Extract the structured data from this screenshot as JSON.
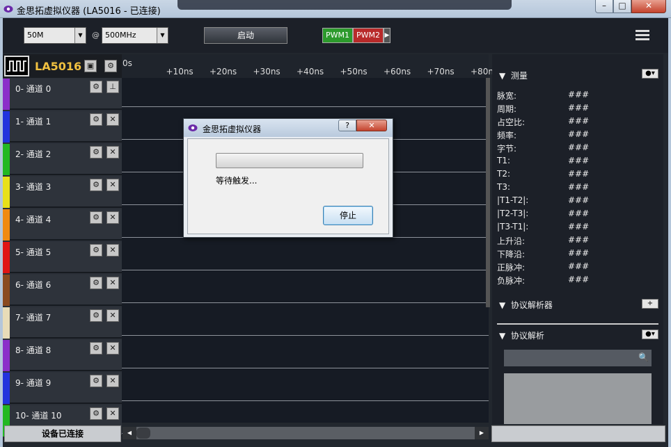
{
  "window": {
    "title": "金思拓虚拟仪器 (LA5016 - 已连接)",
    "min": "–",
    "max": "□",
    "close": "✕"
  },
  "toolbar": {
    "sample_count": "50M",
    "at_symbol": "@",
    "sample_rate": "500MHz",
    "start_label": "启动",
    "pwm1": "PWM1",
    "pwm2": "PWM2",
    "pwm_more": "▶"
  },
  "device": {
    "name": "LA5016"
  },
  "channels": [
    {
      "label": "0-  通道 0",
      "color": "#8b2fc9"
    },
    {
      "label": "1-  通道 1",
      "color": "#2233dd"
    },
    {
      "label": "2-  通道 2",
      "color": "#22b822"
    },
    {
      "label": "3-  通道 3",
      "color": "#e8e01a"
    },
    {
      "label": "4-  通道 4",
      "color": "#f08a10"
    },
    {
      "label": "5-  通道 5",
      "color": "#e01515"
    },
    {
      "label": "6-  通道 6",
      "color": "#8a4a20"
    },
    {
      "label": "7-  通道 7",
      "color": "#e8dcb8"
    },
    {
      "label": "8-  通道 8",
      "color": "#8b2fc9"
    },
    {
      "label": "9-  通道 9",
      "color": "#2233dd"
    },
    {
      "label": "10- 通道 10",
      "color": "#22b822"
    }
  ],
  "ruler": {
    "ticks": [
      "0s",
      "+10ns",
      "+20ns",
      "+30ns",
      "+40ns",
      "+50ns",
      "+60ns",
      "+70ns",
      "+80n"
    ]
  },
  "measure": {
    "title": "测量",
    "rows": [
      {
        "k": "脉宽:",
        "v": "###"
      },
      {
        "k": "周期:",
        "v": "###"
      },
      {
        "k": "占空比:",
        "v": "###"
      },
      {
        "k": "频率:",
        "v": "###"
      },
      {
        "k": "字节:",
        "v": "###"
      },
      {
        "k": "T1:",
        "v": "###"
      },
      {
        "k": "T2:",
        "v": "###"
      },
      {
        "k": "T3:",
        "v": "###"
      },
      {
        "k": "|T1-T2|:",
        "v": "###"
      },
      {
        "k": "|T2-T3|:",
        "v": "###"
      },
      {
        "k": "|T3-T1|:",
        "v": "###"
      },
      {
        "k": "上升沿:",
        "v": "###"
      },
      {
        "k": "下降沿:",
        "v": "###"
      },
      {
        "k": "正脉冲:",
        "v": "###"
      },
      {
        "k": "负脉冲:",
        "v": "###"
      }
    ]
  },
  "analyzers": {
    "title": "协议解析器",
    "add": "+"
  },
  "decode": {
    "title": "协议解析"
  },
  "status": {
    "text": "设备已连接"
  },
  "dialog": {
    "title": "金思拓虚拟仪器",
    "help": "?",
    "close": "✕",
    "message": "等待触发...",
    "stop_label": "停止"
  }
}
